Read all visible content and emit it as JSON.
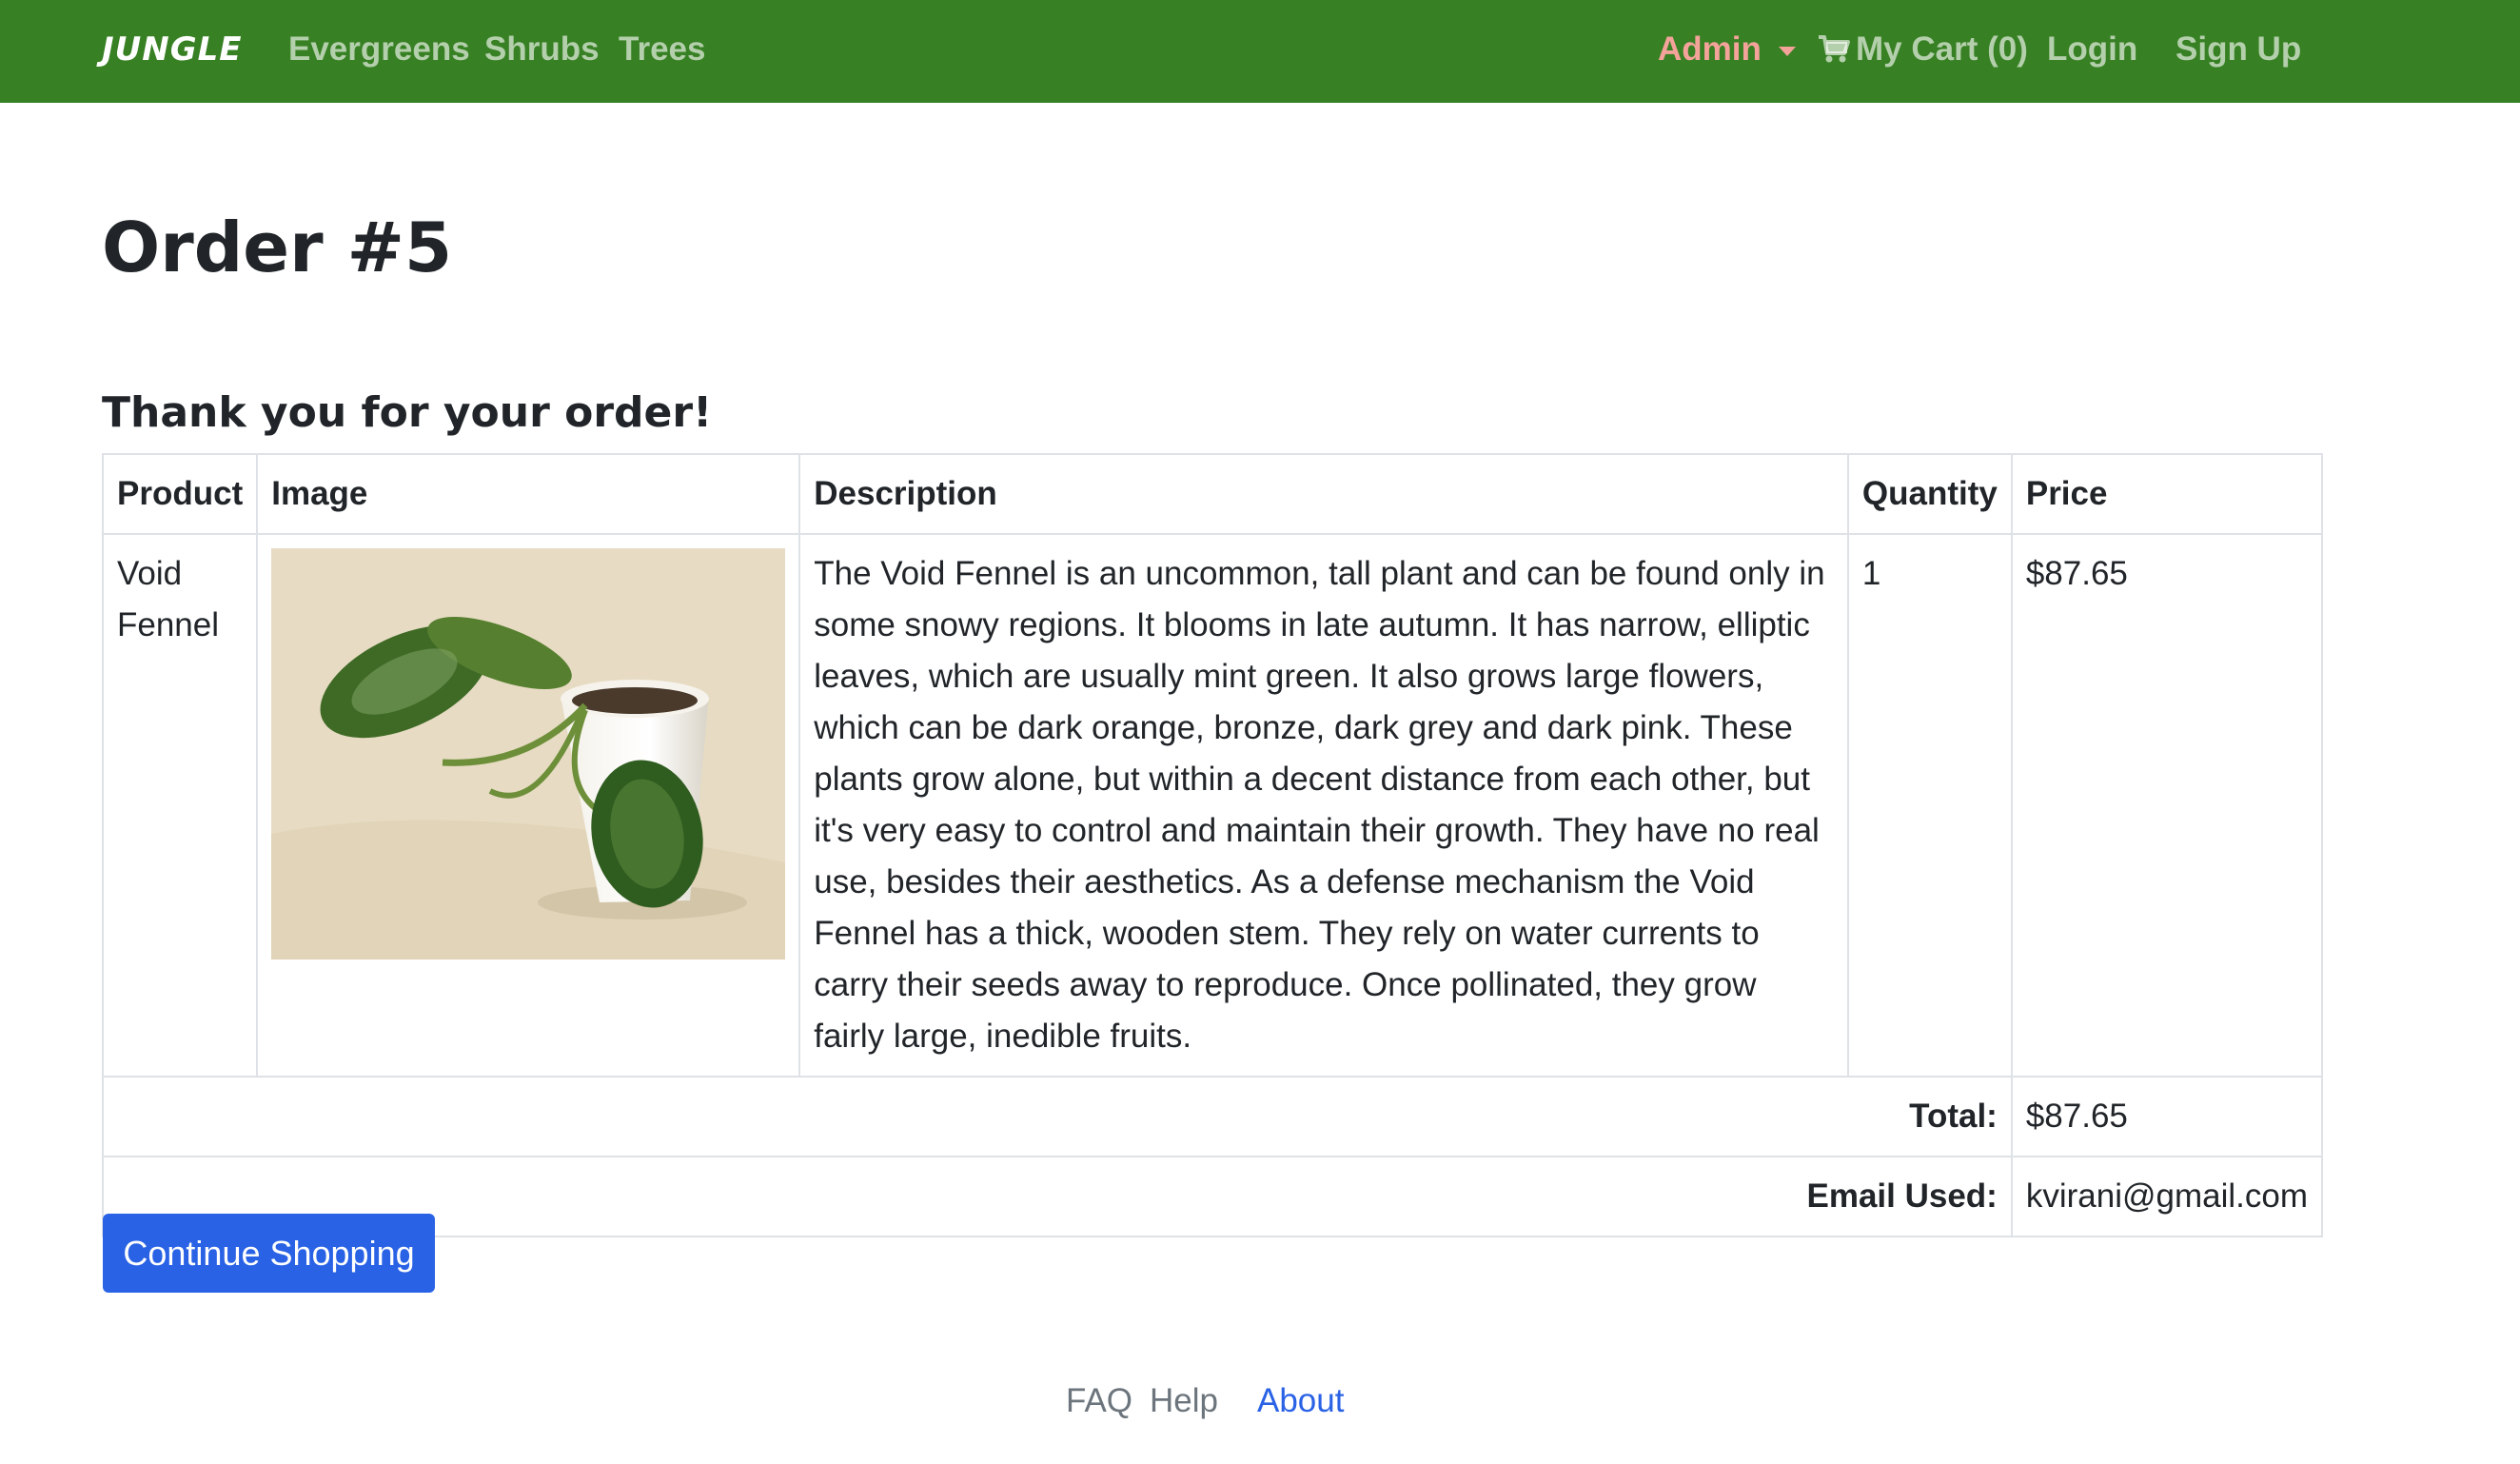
{
  "nav": {
    "brand": "JUNGLE",
    "links": [
      {
        "label": "Evergreens"
      },
      {
        "label": "Shrubs"
      },
      {
        "label": "Trees"
      }
    ],
    "admin_label": "Admin",
    "cart_label": "My Cart (0)",
    "login_label": "Login",
    "signup_label": "Sign Up",
    "colors": {
      "navbar": "#378023",
      "admin": "#f3a39a"
    }
  },
  "page": {
    "title": "Order #5",
    "subtitle": "Thank you for your order!"
  },
  "table": {
    "headers": [
      "Product",
      "Image",
      "Description",
      "Quantity",
      "Price"
    ],
    "rows": [
      {
        "product": "Void Fennel",
        "image_icon": "plant-photo",
        "description": "The Void Fennel is an uncommon, tall plant and can be found only in some snowy regions. It blooms in late autumn. It has narrow, elliptic leaves, which are usually mint green. It also grows large flowers, which can be dark orange, bronze, dark grey and dark pink. These plants grow alone, but within a decent distance from each other, but it's very easy to control and maintain their growth. They have no real use, besides their aesthetics. As a defense mechanism the Void Fennel has a thick, wooden stem. They rely on water currents to carry their seeds away to reproduce. Once pollinated, they grow fairly large, inedible fruits.",
        "quantity": "1",
        "price": "$87.65"
      }
    ],
    "total_label": "Total:",
    "total_value": "$87.65",
    "email_label": "Email Used:",
    "email_value": "kvirani@gmail.com"
  },
  "button": {
    "continue_label": "Continue Shopping",
    "color": "#2a62e6"
  },
  "footer": {
    "faq": "FAQ",
    "help": "Help",
    "about": "About"
  }
}
